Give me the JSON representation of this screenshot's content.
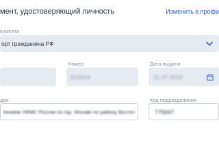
{
  "header": {
    "title": "мент, удостоверяющий личность",
    "edit_link": "Изменить в профи"
  },
  "doc_type": {
    "label": "кумента",
    "value": "орт гражданина РФ",
    "icon": "chevron-down-icon"
  },
  "series": {
    "label": "",
    "value": ""
  },
  "number": {
    "label": "Номер",
    "value": "815819"
  },
  "issue_date": {
    "label": "Дата выдачи",
    "value": "21.07.2019",
    "icon": "calendar-icon"
  },
  "issued_by": {
    "label": "дан",
    "value": "лением УФМС России по гор. Москве по району Восточ"
  },
  "division_code": {
    "label": "Код подразделения",
    "value": "770047"
  },
  "colors": {
    "accent": "#2f62c9",
    "field_bg": "#e6ebf2",
    "label": "#8a93a3"
  }
}
